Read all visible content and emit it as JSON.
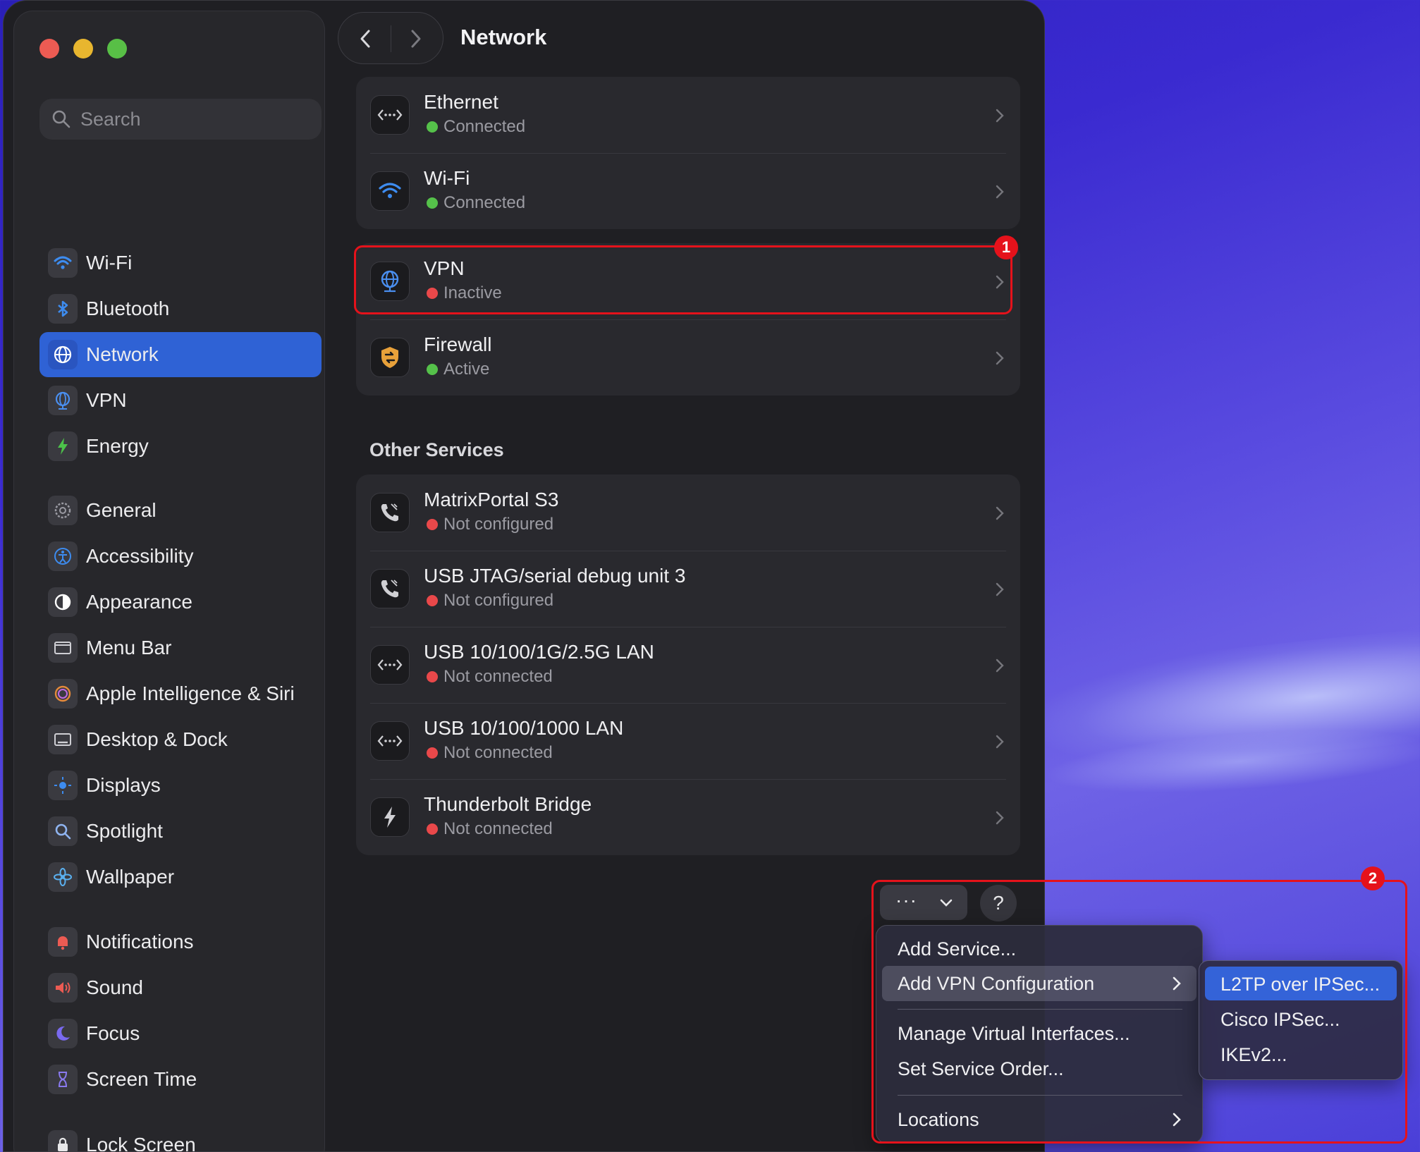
{
  "window": {
    "title": "Network"
  },
  "search": {
    "placeholder": "Search"
  },
  "sidebar": {
    "items": [
      {
        "label": "Wi-Fi",
        "icon": "wifi-icon"
      },
      {
        "label": "Bluetooth",
        "icon": "bluetooth-icon"
      },
      {
        "label": "Network",
        "icon": "globe-icon",
        "selected": true
      },
      {
        "label": "VPN",
        "icon": "vpn-globe-icon"
      },
      {
        "label": "Energy",
        "icon": "bolt-icon"
      },
      {
        "label": "General",
        "icon": "gear-icon"
      },
      {
        "label": "Accessibility",
        "icon": "accessibility-icon"
      },
      {
        "label": "Appearance",
        "icon": "appearance-icon"
      },
      {
        "label": "Menu Bar",
        "icon": "menubar-icon"
      },
      {
        "label": "Apple Intelligence & Siri",
        "icon": "siri-icon"
      },
      {
        "label": "Desktop & Dock",
        "icon": "dock-icon"
      },
      {
        "label": "Displays",
        "icon": "sun-icon"
      },
      {
        "label": "Spotlight",
        "icon": "magnifier-icon"
      },
      {
        "label": "Wallpaper",
        "icon": "flower-icon"
      },
      {
        "label": "Notifications",
        "icon": "bell-icon"
      },
      {
        "label": "Sound",
        "icon": "speaker-icon"
      },
      {
        "label": "Focus",
        "icon": "moon-icon"
      },
      {
        "label": "Screen Time",
        "icon": "hourglass-icon"
      },
      {
        "label": "Lock Screen",
        "icon": "lock-icon"
      }
    ]
  },
  "services": [
    {
      "name": "Ethernet",
      "status": "Connected",
      "state": "green",
      "icon": "ethernet-icon"
    },
    {
      "name": "Wi-Fi",
      "status": "Connected",
      "state": "green",
      "icon": "wifi-icon"
    },
    {
      "name": "VPN",
      "status": "Inactive",
      "state": "red",
      "icon": "vpn-globe-icon"
    },
    {
      "name": "Firewall",
      "status": "Active",
      "state": "green",
      "icon": "firewall-shield-icon"
    }
  ],
  "other_services": {
    "heading": "Other Services",
    "items": [
      {
        "name": "MatrixPortal S3",
        "status": "Not configured",
        "icon": "phone-modem-icon"
      },
      {
        "name": "USB JTAG/serial debug unit 3",
        "status": "Not configured",
        "icon": "phone-modem-icon"
      },
      {
        "name": "USB 10/100/1G/2.5G LAN",
        "status": "Not connected",
        "icon": "ethernet-icon"
      },
      {
        "name": "USB 10/100/1000 LAN",
        "status": "Not connected",
        "icon": "ethernet-icon"
      },
      {
        "name": "Thunderbolt Bridge",
        "status": "Not connected",
        "icon": "thunderbolt-icon"
      }
    ]
  },
  "toolbar": {
    "more_label": "···",
    "help_label": "?"
  },
  "menu": {
    "items": [
      "Add Service...",
      "Add VPN Configuration",
      "Manage Virtual Interfaces...",
      "Set Service Order...",
      "Locations"
    ]
  },
  "submenu": {
    "items": [
      "L2TP over IPSec...",
      "Cisco IPSec...",
      "IKEv2..."
    ]
  },
  "annotations": {
    "badge1": "1",
    "badge2": "2"
  },
  "colors": {
    "accent": "#2f62d5",
    "highlight": "#e5121b",
    "connected": "#55c14a",
    "inactive": "#e9484a"
  }
}
